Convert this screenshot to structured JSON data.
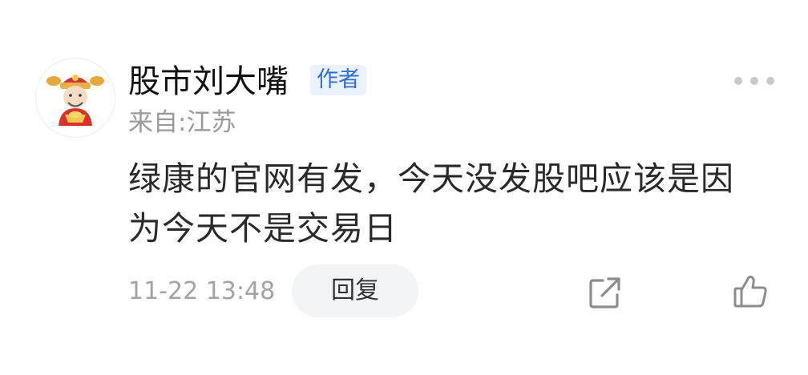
{
  "comment": {
    "user": {
      "name": "股市刘大嘴",
      "badge": "作者",
      "location": "来自:江苏",
      "avatar_icon": "caishen-avatar-icon"
    },
    "text": "绿康的官网有发，今天没发股吧应该是因为今天不是交易日",
    "timestamp": "11-22 13:48",
    "actions": {
      "reply_label": "回复",
      "share_icon": "share-icon",
      "like_icon": "thumbs-up-icon",
      "more_icon": "more-dots-icon"
    }
  },
  "colors": {
    "badge_bg": "#e9f2fd",
    "badge_text": "#2f6fd0",
    "muted_text": "#a3a3a3",
    "reply_bg": "#f3f4f6"
  }
}
